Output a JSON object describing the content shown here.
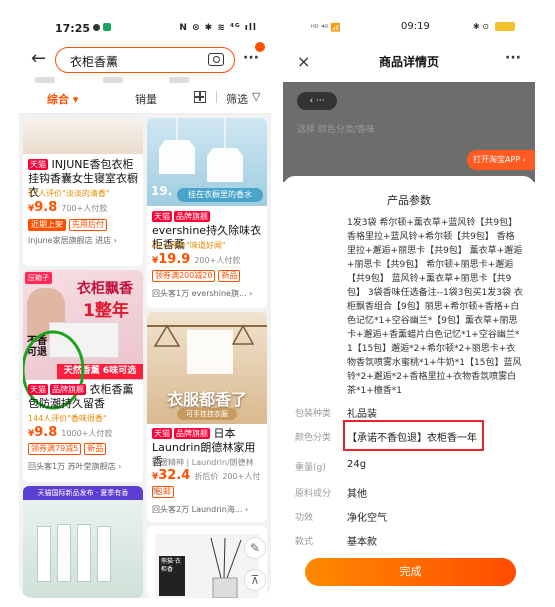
{
  "left": {
    "status": {
      "time": "17:25",
      "icons": "N ⊙ ✱ ≋ ⁴ᴳ ıll"
    },
    "search": {
      "query": "衣柜香薰",
      "badge": ""
    },
    "filters": {
      "tab_sort": "综合 ▾",
      "tab_sales": "销量",
      "tab_filter": "筛选"
    },
    "products": [
      {
        "tmall": "天猫",
        "title": "INJUNE香包衣柜挂钩香囊女生寝室衣橱衣",
        "rank": "17人评价\"淡淡的清香\"",
        "price": "9.8",
        "paid": "700+人付款",
        "tags": [
          "近期上架",
          "先用后付"
        ],
        "shop": "injune家居旗舰店 进店 ›"
      },
      {
        "img_caption": "挂在衣橱里的香水",
        "tmall": "天猫",
        "brand": "品牌旗舰",
        "title": "evershine持久除味衣柜香薰",
        "rank": "21人评价\"味道好闻\"",
        "price": "19.9",
        "paid": "200+人付款",
        "tags": [
          "领券满200减20",
          "新品"
        ],
        "shop": "回头客1万 evershine旗... ›"
      },
      {
        "img_title1": "衣柜飘香",
        "img_title2": "1整年",
        "img_flag": "压箱子",
        "img_left1": "不香",
        "img_left2": "可退",
        "img_banner": "天然香薰 6味可选",
        "tmall": "天猫",
        "brand": "品牌旗舰",
        "title": "衣柜香薰包防潮持久留香",
        "rank": "144人评价\"香味很香\"",
        "price": "9.8",
        "paid": "1000+人付款",
        "tags": [
          "领券满79减5",
          "新品"
        ],
        "shop": "回头客1万 苏叶堂旗舰店 ›"
      },
      {
        "img_title": "衣服都香了",
        "img_sub": "可手挂挂衣服",
        "tmall": "天猫",
        "brand": "品牌旗舰",
        "title_suffix": "日本",
        "title": "Laundrin朗德林家用香",
        "meta": "舒缓精神 | Laundrin/朗德林",
        "price": "32.4",
        "price_note": "折后价",
        "paid": "200+人付款",
        "tags": [
          "包邮"
        ],
        "shop": "回头客2万 Laundrin海... ›"
      }
    ],
    "bottom_banner": "天猫国际新品发布 · 夏季有香",
    "bottom_right_caption": "熊猫·衣柜香"
  },
  "right": {
    "status": {
      "time": "09:19",
      "signal": "ᴴᴰ ⁴ᴳ 📶",
      "bt": "✱ ⊙"
    },
    "nav": {
      "title": "商品详情页",
      "close": "×",
      "more": "···"
    },
    "behind": {
      "row1": "选择  颜色分类/香味",
      "open_app": "打开淘宝APP ›"
    },
    "sheet": {
      "heading": "产品参数",
      "description": "1发3袋 希尔顿+薰衣草+蓝风铃【共9包】 香格里拉+蓝风铃+希尔顿【共9包】 香格里拉+邂逅+丽思卡【共9包】 薰衣草+邂逅+丽思卡【共9包】 希尔顿+丽思卡+邂逅【共9包】 蓝风铃+薰衣草+丽思卡【共9包】 3袋香味任选备注--1袋3包买1发3袋 衣柜飘香组合【9包】丽思+希尔顿+香格+白色记忆*1+空谷幽兰*【9包】薰衣草+丽思卡+邂逅+香薰蜡片白色记忆*1+空谷幽兰*1【15包】邂逅*2+希尔顿*2+丽思卡+衣物香氛喷雾水蜜桃*1+牛奶*1【15包】蓝风铃*2+邂逅*2+香格里拉+衣物香氛喷雾白茶*1+檀香*1",
      "rows": [
        {
          "label": "包装种类",
          "value": "礼品装"
        },
        {
          "label": "颜色分类",
          "value": "【承诺不香包退】衣柜香一年"
        },
        {
          "label": "重量(g)",
          "value": "24g"
        },
        {
          "label": "原料成分",
          "value": "其他"
        },
        {
          "label": "功效",
          "value": "净化空气"
        },
        {
          "label": "款式",
          "value": "基本款"
        }
      ],
      "done": "完成"
    }
  }
}
